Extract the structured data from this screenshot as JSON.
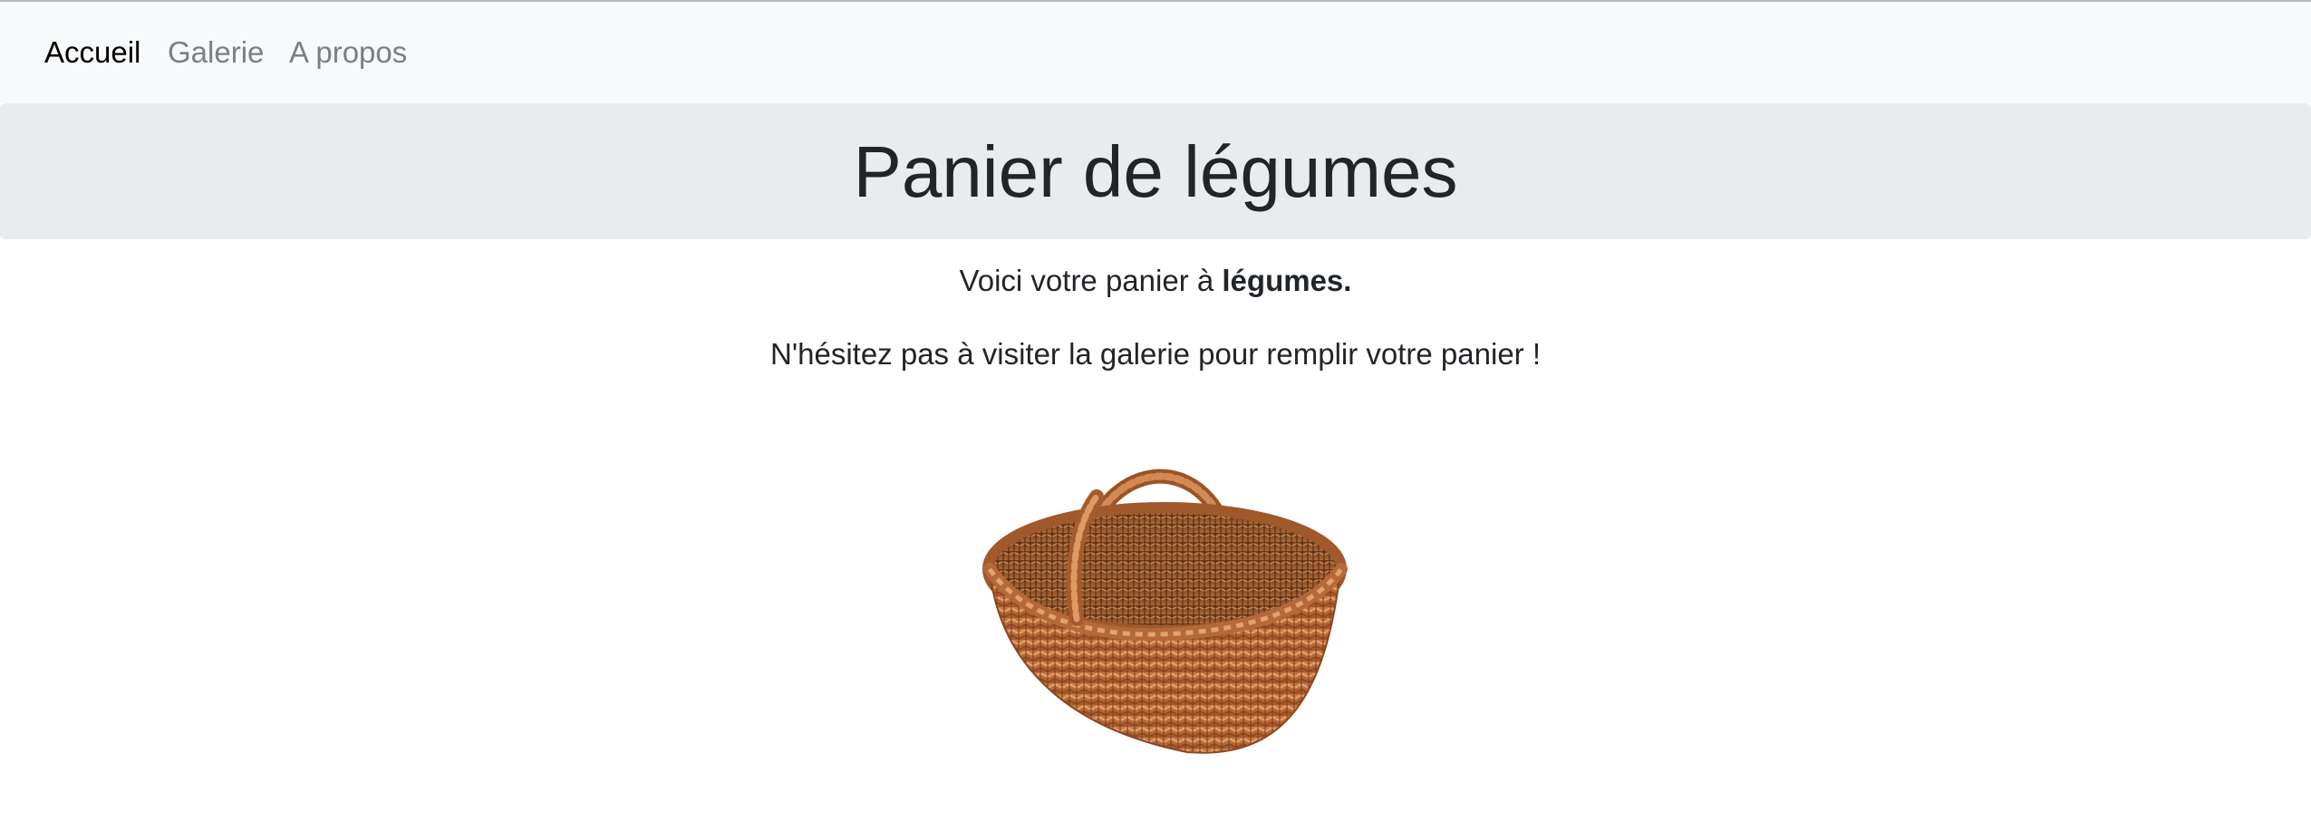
{
  "nav": {
    "items": [
      {
        "label": "Accueil",
        "active": true
      },
      {
        "label": "Galerie",
        "active": false
      },
      {
        "label": "A propos",
        "active": false
      }
    ]
  },
  "header": {
    "title": "Panier de légumes"
  },
  "content": {
    "intro_text": "Voici votre panier à ",
    "intro_bold": "légumes.",
    "cta_text": "N'hésitez pas à visiter la galerie pour remplir votre panier !"
  },
  "image": {
    "icon": "wicker-basket-image"
  },
  "colors": {
    "navbar_bg": "#f8f9fa",
    "jumbotron_bg": "#e9ecef",
    "nav_active": "#000000",
    "nav_inactive": "#7c7f82",
    "text": "#212529"
  }
}
